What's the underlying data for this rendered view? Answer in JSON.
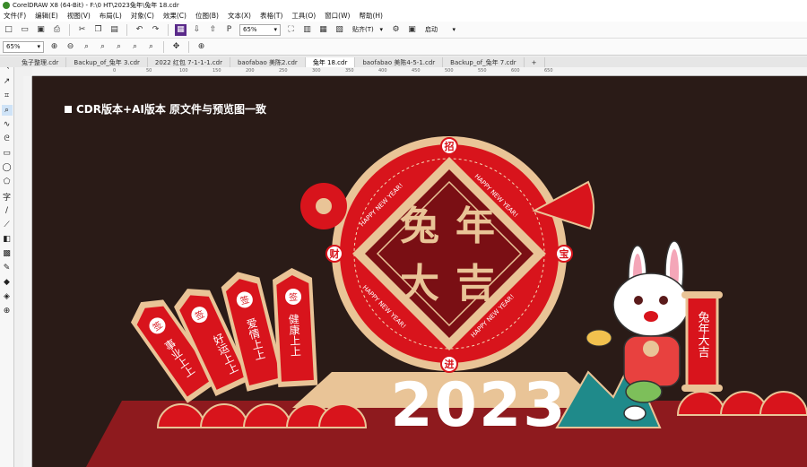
{
  "window": {
    "title": "CorelDRAW X8 (64-Bit) - F:\\0 HT\\2023兔年\\兔年 18.cdr"
  },
  "menu": [
    "文件(F)",
    "编辑(E)",
    "视图(V)",
    "布局(L)",
    "对象(C)",
    "效果(C)",
    "位图(B)",
    "文本(X)",
    "表格(T)",
    "工具(O)",
    "窗口(W)",
    "帮助(H)"
  ],
  "toolbar": {
    "zoom_value": "65%",
    "snap_label": "贴齐(T)",
    "launch_label": "启动"
  },
  "toolbar2": {
    "zoom_value": "65%"
  },
  "tabs": [
    "兔子整理.cdr",
    "Backup_of_兔年 3.cdr",
    "2022 红包 7-1-1-1.cdr",
    "baofabao 美陈2.cdr",
    "兔年 18.cdr",
    "baofabao 美陈4-5-1.cdr",
    "Backup_of_兔年 7.cdr"
  ],
  "active_tab": 4,
  "ruler_ticks": [
    "0",
    "50",
    "100",
    "150",
    "200",
    "250",
    "300",
    "350",
    "400",
    "450",
    "500",
    "550",
    "600",
    "650"
  ],
  "canvas": {
    "caption": "CDR版本+AI版本   原文件与预览图一致",
    "main_chars": [
      "兔",
      "年",
      "大",
      "吉"
    ],
    "corner_chars": {
      "top": "招",
      "left": "财",
      "right": "宝",
      "bottom": "进"
    },
    "ring_text": "HAPPY NEW YEAR!",
    "year": "2023",
    "lots": [
      {
        "seal": "签",
        "text": "事业上上"
      },
      {
        "seal": "签",
        "text": "好运上上"
      },
      {
        "seal": "签",
        "text": "爱情上上"
      },
      {
        "seal": "签",
        "text": "健康上上"
      }
    ],
    "scroll_text": "兔年大吉",
    "colors": {
      "bg": "#2a1b17",
      "red": "#d8141c",
      "gold": "#e9c497",
      "floor": "#8e1a1e"
    }
  }
}
